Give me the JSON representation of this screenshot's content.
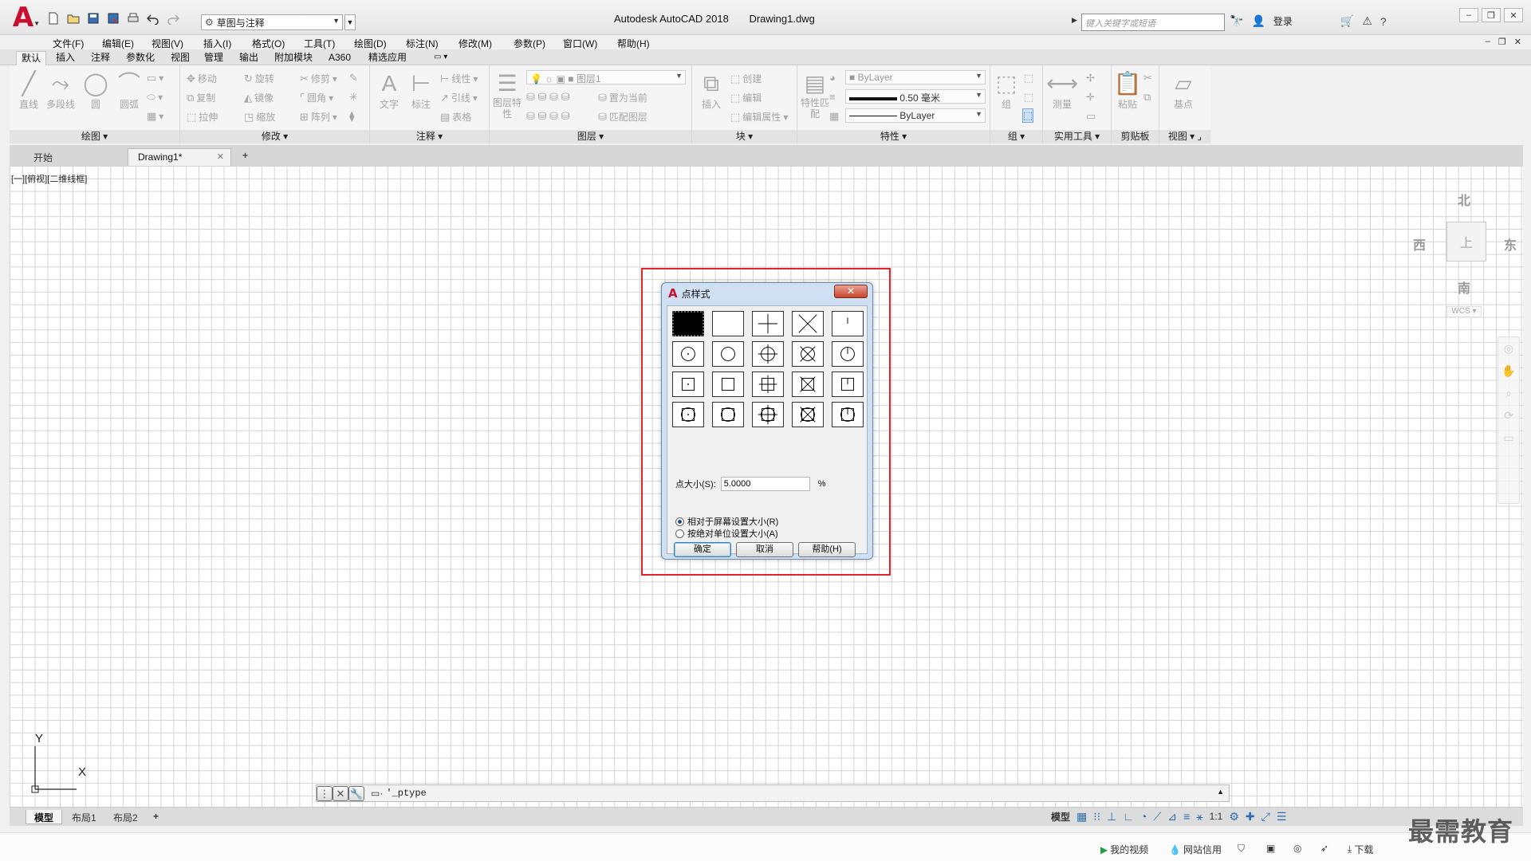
{
  "titlebar": {
    "workspace": "草图与注释",
    "app_name": "Autodesk AutoCAD 2018",
    "file_name": "Drawing1.dwg",
    "search_placeholder": "键入关键字或短语",
    "login": "登录"
  },
  "menu": [
    "文件(F)",
    "编辑(E)",
    "视图(V)",
    "插入(I)",
    "格式(O)",
    "工具(T)",
    "绘图(D)",
    "标注(N)",
    "修改(M)",
    "参数(P)",
    "窗口(W)",
    "帮助(H)"
  ],
  "ribbon_tabs": [
    "默认",
    "插入",
    "注释",
    "参数化",
    "视图",
    "管理",
    "输出",
    "附加模块",
    "A360",
    "精选应用"
  ],
  "panels": {
    "draw": {
      "title": "绘图",
      "line": "直线",
      "polyline": "多段线",
      "circle": "圆",
      "arc": "圆弧"
    },
    "modify": {
      "title": "修改",
      "move": "移动",
      "rotate": "旋转",
      "trim": "修剪",
      "copy": "复制",
      "mirror": "镜像",
      "fillet": "圆角",
      "stretch": "拉伸",
      "scale": "缩放",
      "array": "阵列"
    },
    "annotation": {
      "title": "注释",
      "text": "文字",
      "dimension": "标注",
      "linear": "线性",
      "leader": "引线",
      "table": "表格"
    },
    "layers": {
      "title": "图层",
      "layer_props": "图层特性",
      "current_layer": "图层1",
      "set_current": "置为当前",
      "match_layer": "匹配图层"
    },
    "block": {
      "title": "块",
      "insert": "插入",
      "create": "创建",
      "edit": "编辑",
      "edit_attr": "编辑属性"
    },
    "properties": {
      "title": "特性",
      "match_props": "特性匹配",
      "color": "ByLayer",
      "lineweight": "0.50 毫米",
      "linetype": "ByLayer"
    },
    "groups": {
      "title": "组",
      "group": "组"
    },
    "utilities": {
      "title": "实用工具",
      "measure": "测量"
    },
    "clipboard": {
      "title": "剪贴板",
      "paste": "粘贴"
    },
    "view": {
      "title": "视图",
      "base": "基点"
    }
  },
  "file_tabs": {
    "start": "开始",
    "drawing": "Drawing1*"
  },
  "viewport": {
    "label": "[一][俯视][二维线框]",
    "north": "北",
    "south": "南",
    "east": "东",
    "west": "西",
    "top": "上",
    "wcs": "WCS"
  },
  "ucs": {
    "x": "X",
    "y": "Y"
  },
  "command": {
    "value": "'_ptype"
  },
  "layout_tabs": [
    "模型",
    "布局1",
    "布局2"
  ],
  "status": {
    "model": "模型",
    "scale": "1:1"
  },
  "bottom": {
    "videos": "我的视频",
    "net": "网站信用",
    "download": "下载"
  },
  "watermark": "最需教育",
  "dialog": {
    "title": "点样式",
    "size_label": "点大小(S):",
    "size_value": "5.0000",
    "unit": "%",
    "radio_relative": "相对于屏幕设置大小(R)",
    "radio_absolute": "按绝对单位设置大小(A)",
    "ok": "确定",
    "cancel": "取消",
    "help": "帮助(H)"
  }
}
